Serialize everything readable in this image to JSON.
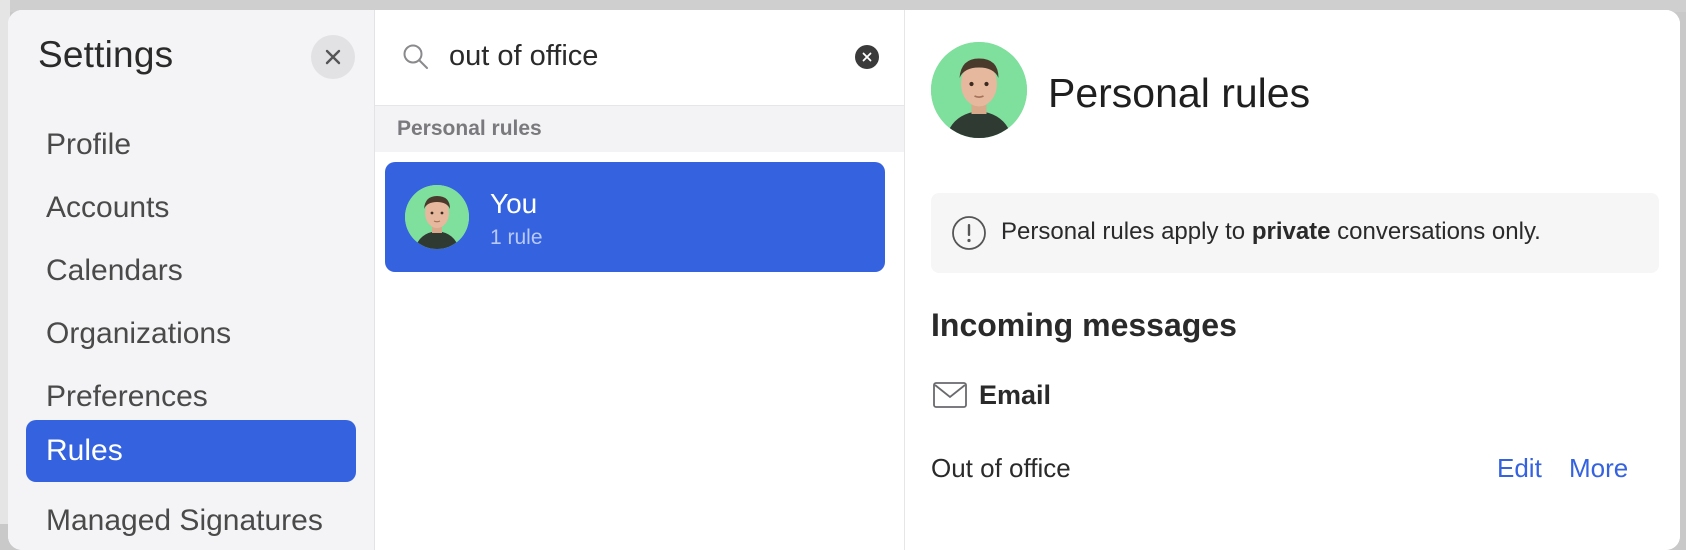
{
  "colors": {
    "accent": "#3563e0",
    "sidebar_bg": "#f4f4f6",
    "avatar_bg": "#7fdf9c"
  },
  "sidebar": {
    "title": "Settings",
    "close_icon": "close-icon",
    "items": [
      {
        "label": "Profile",
        "active": false
      },
      {
        "label": "Accounts",
        "active": false
      },
      {
        "label": "Calendars",
        "active": false
      },
      {
        "label": "Organizations",
        "active": false
      },
      {
        "label": "Preferences",
        "active": false
      },
      {
        "label": "Rules",
        "active": true
      },
      {
        "label": "Managed Signatures",
        "active": false
      }
    ]
  },
  "search": {
    "value": "out of office",
    "icon": "search-icon",
    "clear_icon": "clear-icon"
  },
  "results": {
    "section_label": "Personal rules",
    "items": [
      {
        "name": "You",
        "count": "1 rule",
        "selected": true
      }
    ]
  },
  "detail": {
    "title": "Personal rules",
    "notice": {
      "icon": "info-icon",
      "prefix": "Personal rules apply to ",
      "emphasis": "private",
      "suffix": " conversations only."
    },
    "incoming_title": "Incoming messages",
    "channel": {
      "icon": "mail-icon",
      "label": "Email"
    },
    "rule": {
      "label": "Out of office",
      "edit": "Edit",
      "more": "More"
    }
  }
}
